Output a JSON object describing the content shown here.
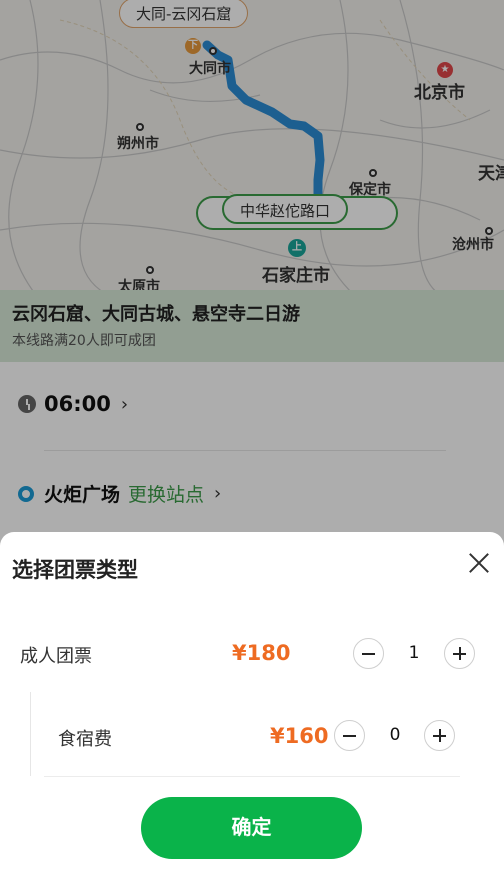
{
  "map": {
    "route_label_top": "大同-云冈石窟",
    "route_label_mid": "中华赵佗路口",
    "marker_drop": "下",
    "marker_board": "上",
    "cities": {
      "datong": "大同市",
      "shuozhou": "朔州市",
      "beijing": "北京市",
      "baoding": "保定市",
      "tianjin": "天津",
      "cangzhou": "沧州市",
      "shijiazhuang": "石家庄市",
      "taiyuan": "太原市"
    },
    "colors": {
      "route": "#2b8cd4",
      "background": "#f2f1ec"
    }
  },
  "trip": {
    "title": "云冈石窟、大同古城、悬空寺二日游",
    "subtitle": "本线路满20人即可成团"
  },
  "detail": {
    "departure_time": "06:00",
    "station": "火炬广场",
    "change_station": "更换站点"
  },
  "sheet": {
    "title": "选择团票类型",
    "items": [
      {
        "label": "成人团票",
        "price": "¥180",
        "quantity": "1"
      },
      {
        "label": "食宿费",
        "price": "¥160",
        "quantity": "0"
      }
    ],
    "confirm": "确定"
  },
  "colors": {
    "accent": "#0ab34a",
    "price": "#ee6b22"
  }
}
